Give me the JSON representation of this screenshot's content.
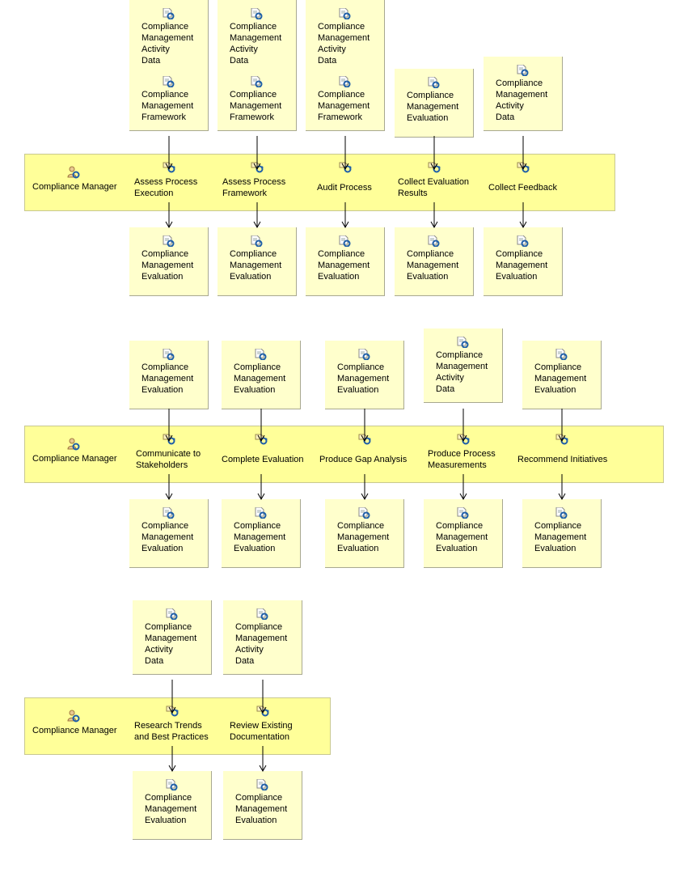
{
  "colors": {
    "lane": "#ffff99",
    "artifact": "#ffffcc",
    "icon_blue": "#1f5fa8"
  },
  "lanes": [
    {
      "role": "Compliance Manager",
      "tasks": [
        {
          "label": "Assess Process\nExecution",
          "inputs": [
            "Compliance\nManagement\nActivity\nData",
            "Compliance\nManagement\nFramework"
          ],
          "outputs": [
            "Compliance\nManagement\nEvaluation"
          ]
        },
        {
          "label": "Assess Process\nFramework",
          "inputs": [
            "Compliance\nManagement\nActivity\nData",
            "Compliance\nManagement\nFramework"
          ],
          "outputs": [
            "Compliance\nManagement\nEvaluation"
          ]
        },
        {
          "label": "Audit Process",
          "inputs": [
            "Compliance\nManagement\nActivity\nData",
            "Compliance\nManagement\nFramework"
          ],
          "outputs": [
            "Compliance\nManagement\nEvaluation"
          ]
        },
        {
          "label": "Collect Evaluation\nResults",
          "inputs": [
            "Compliance\nManagement\nEvaluation"
          ],
          "outputs": [
            "Compliance\nManagement\nEvaluation"
          ]
        },
        {
          "label": "Collect Feedback",
          "inputs": [
            "Compliance\nManagement\nActivity\nData"
          ],
          "outputs": [
            "Compliance\nManagement\nEvaluation"
          ]
        }
      ]
    },
    {
      "role": "Compliance Manager",
      "tasks": [
        {
          "label": "Communicate to\nStakeholders",
          "inputs": [
            "Compliance\nManagement\nEvaluation"
          ],
          "outputs": [
            "Compliance\nManagement\nEvaluation"
          ]
        },
        {
          "label": "Complete Evaluation",
          "inputs": [
            "Compliance\nManagement\nEvaluation"
          ],
          "outputs": [
            "Compliance\nManagement\nEvaluation"
          ]
        },
        {
          "label": "Produce Gap Analysis",
          "inputs": [
            "Compliance\nManagement\nEvaluation"
          ],
          "outputs": [
            "Compliance\nManagement\nEvaluation"
          ]
        },
        {
          "label": "Produce Process\nMeasurements",
          "inputs": [
            "Compliance\nManagement\nActivity\nData"
          ],
          "outputs": [
            "Compliance\nManagement\nEvaluation"
          ]
        },
        {
          "label": "Recommend Initiatives",
          "inputs": [
            "Compliance\nManagement\nEvaluation"
          ],
          "outputs": [
            "Compliance\nManagement\nEvaluation"
          ]
        }
      ]
    },
    {
      "role": "Compliance Manager",
      "tasks": [
        {
          "label": "Research Trends\nand Best Practices",
          "inputs": [
            "Compliance\nManagement\nActivity\nData"
          ],
          "outputs": [
            "Compliance\nManagement\nEvaluation"
          ]
        },
        {
          "label": "Review Existing\nDocumentation",
          "inputs": [
            "Compliance\nManagement\nActivity\nData"
          ],
          "outputs": [
            "Compliance\nManagement\nEvaluation"
          ]
        }
      ]
    }
  ]
}
